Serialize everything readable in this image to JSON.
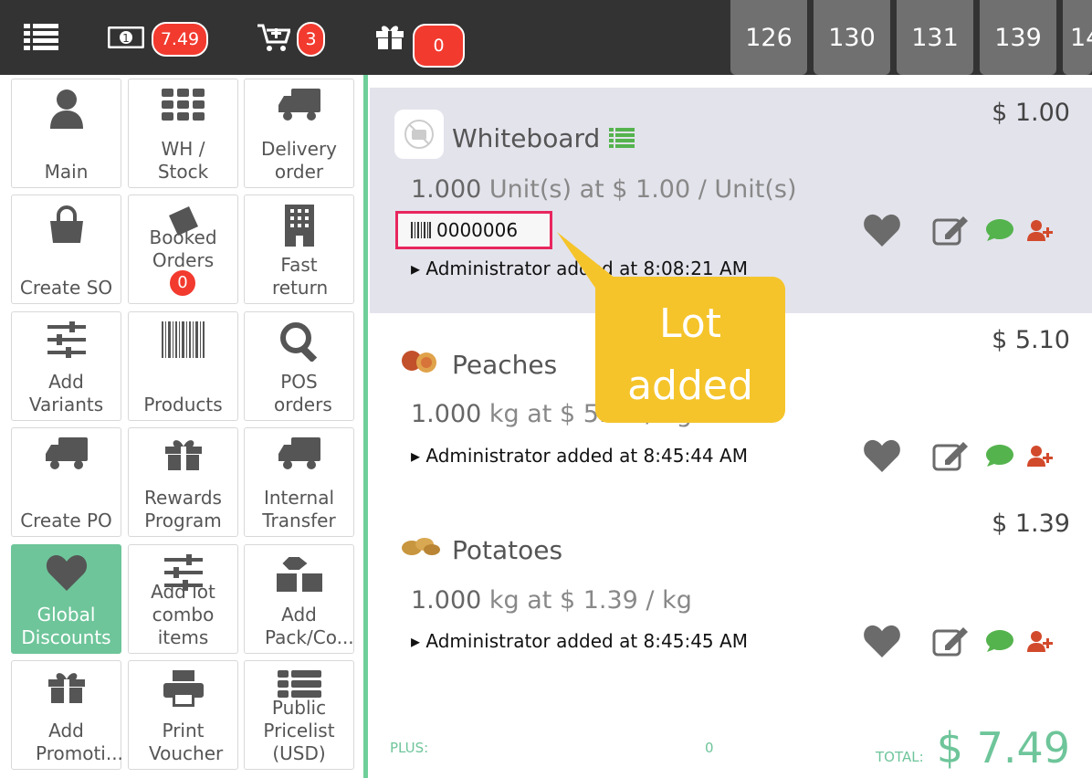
{
  "topbar": {
    "cash_amount": "7.49",
    "cart_count": "3",
    "gift_count": "0",
    "tables": [
      "126",
      "130",
      "131",
      "139",
      "14"
    ]
  },
  "menu": {
    "main": "Main",
    "wh_stock": "WH / Stock",
    "delivery_order": "Delivery order",
    "create_so": "Create SO",
    "booked_orders": "Booked Orders",
    "booked_count": "0",
    "fast_return": "Fast return",
    "add_variants": "Add Variants",
    "products": "Products",
    "pos_orders": "POS orders",
    "create_po": "Create PO",
    "rewards_program": "Rewards Program",
    "internal_transfer": "Internal Transfer",
    "global_discounts": "Global Discounts",
    "add_lot_combo": "Add lot combo items",
    "add_pack": "Add Pack/Co...",
    "add_promotion": "Add Promoti...",
    "print_voucher": "Print Voucher",
    "public_pricelist": "Public Pricelist (USD)"
  },
  "orderlines": [
    {
      "name": "Whiteboard",
      "price": "$ 1.00",
      "qty": "1.000",
      "unit_text": "Unit(s) at $ 1.00 / Unit(s)",
      "lot": "0000006",
      "note": "Administrator added at 8:08:21 AM"
    },
    {
      "name": "Peaches",
      "price": "$ 5.10",
      "qty": "1.000",
      "unit_text": "kg at $ 5.10 / kg",
      "note": "Administrator added at 8:45:44 AM"
    },
    {
      "name": "Potatoes",
      "price": "$ 1.39",
      "qty": "1.000",
      "unit_text": "kg at $ 1.39 / kg",
      "note": "Administrator added at 8:45:45 AM"
    }
  ],
  "footer": {
    "plus_label": "PLUS:",
    "plus_value": "0",
    "total_label": "TOTAL:",
    "total_value": "$ 7.49"
  },
  "callout": {
    "text_line1": "Lot",
    "text_line2": "added"
  },
  "colors": {
    "accent_green": "#6ec59a",
    "badge_red": "#f23a2f",
    "callout_yellow": "#f5c42a",
    "lot_border": "#e8265e"
  }
}
